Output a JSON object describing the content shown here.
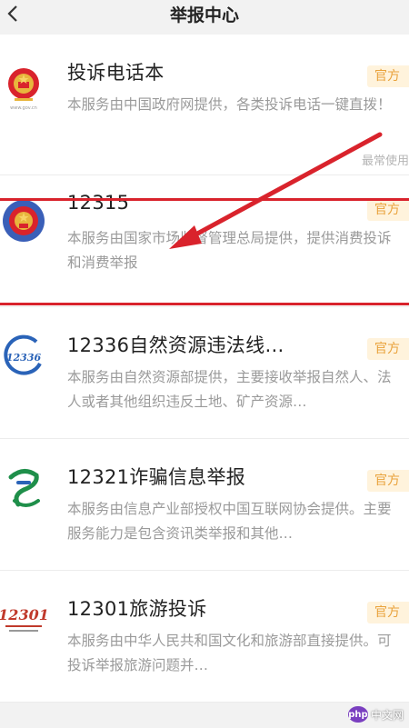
{
  "header": {
    "title": "举报中心"
  },
  "items": [
    {
      "title": "投诉电话本",
      "badge": "官方",
      "description": "本服务由中国政府网提供，各类投诉电话一键直拨！",
      "tag": "最常使用",
      "logo_watermark": "www.gov.cn"
    },
    {
      "title": "12315",
      "badge": "官方",
      "description": "本服务由国家市场监督管理总局提供，提供消费投诉和消费举报"
    },
    {
      "title": "12336自然资源违法线…",
      "badge": "官方",
      "description": "本服务由自然资源部提供，主要接收举报自然人、法人或者其他组织违反土地、矿产资源…",
      "logo_text": "12336"
    },
    {
      "title": "12321诈骗信息举报",
      "badge": "官方",
      "description": "本服务由信息产业部授权中国互联网协会提供。主要服务能力是包含资讯类举报和其他…"
    },
    {
      "title": "12301旅游投诉",
      "badge": "官方",
      "description": "本服务由中华人民共和国文化和旅游部直接提供。可投诉举报旅游问题并…",
      "logo_text": "12301"
    }
  ],
  "watermark": {
    "brand": "php",
    "text": "中文网"
  },
  "colors": {
    "badge_text": "#e9a23b",
    "badge_bg": "#fff3dc",
    "highlight": "#d9232c"
  }
}
